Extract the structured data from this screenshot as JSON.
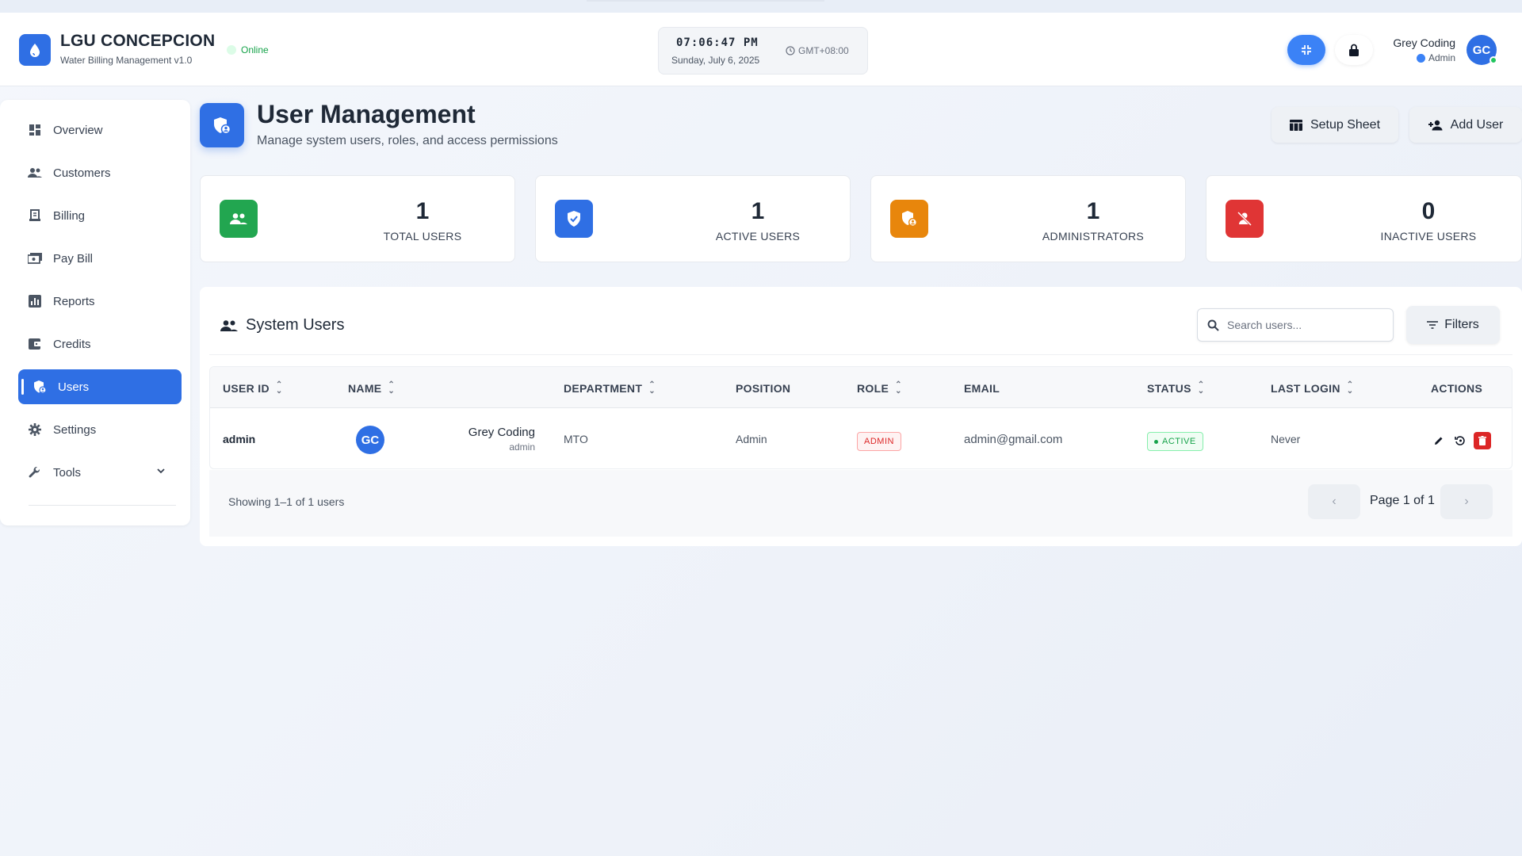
{
  "app": {
    "title": "LGU CONCEPCION",
    "subtitle": "Water Billing Management v1.0",
    "status": "Online"
  },
  "clock": {
    "time": "07:06:47 PM",
    "date": "Sunday, July 6, 2025",
    "timezone": "GMT+08:00"
  },
  "user": {
    "name": "Grey Coding",
    "role": "Admin",
    "initials": "GC"
  },
  "sidebar": {
    "items": [
      {
        "label": "Overview",
        "icon": "dashboard-icon"
      },
      {
        "label": "Customers",
        "icon": "people-icon"
      },
      {
        "label": "Billing",
        "icon": "receipt-icon"
      },
      {
        "label": "Pay Bill",
        "icon": "payment-icon"
      },
      {
        "label": "Reports",
        "icon": "chart-icon"
      },
      {
        "label": "Credits",
        "icon": "wallet-icon"
      },
      {
        "label": "Users",
        "icon": "shield-user-icon",
        "active": true
      },
      {
        "label": "Settings",
        "icon": "gear-icon"
      },
      {
        "label": "Tools",
        "icon": "wrench-icon"
      }
    ]
  },
  "page": {
    "title": "User Management",
    "subtitle": "Manage system users, roles, and access permissions",
    "setup_label": "Setup Sheet",
    "add_label": "Add User"
  },
  "stats": [
    {
      "value": "1",
      "label": "TOTAL USERS",
      "color": "#22a650"
    },
    {
      "value": "1",
      "label": "ACTIVE USERS",
      "color": "#2f6fe4"
    },
    {
      "value": "1",
      "label": "ADMINISTRATORS",
      "color": "#e8860c"
    },
    {
      "value": "0",
      "label": "INACTIVE USERS",
      "color": "#e03535"
    }
  ],
  "users_panel": {
    "title": "System Users",
    "search_placeholder": "Search users...",
    "filters_label": "Filters",
    "columns": [
      "USER ID",
      "NAME",
      "DEPARTMENT",
      "POSITION",
      "ROLE",
      "EMAIL",
      "STATUS",
      "LAST LOGIN",
      "ACTIONS"
    ],
    "rows": [
      {
        "user_id": "admin",
        "initials": "GC",
        "name": "Grey Coding",
        "username": "admin",
        "department": "MTO",
        "position": "Admin",
        "role": "ADMIN",
        "email": "admin@gmail.com",
        "status": "ACTIVE",
        "last_login": "Never"
      }
    ],
    "showing": "Showing 1–1 of 1 users",
    "page_info": "Page 1 of 1",
    "prev": "‹",
    "next": "›"
  }
}
